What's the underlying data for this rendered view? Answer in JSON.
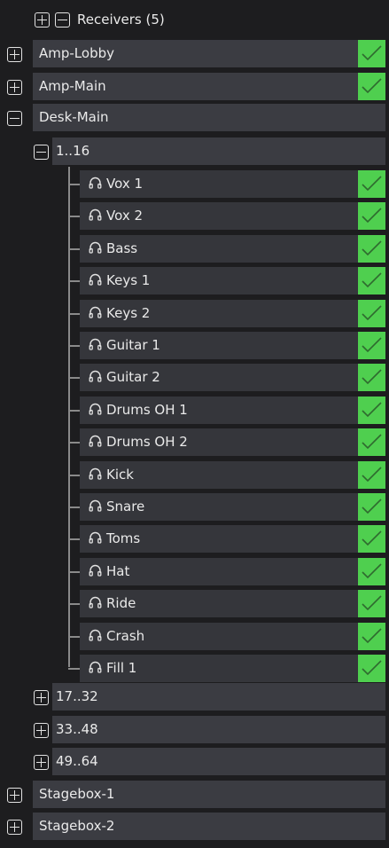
{
  "header": {
    "title": "Receivers",
    "count": "(5)"
  },
  "receivers": [
    {
      "label": "Amp-Lobby",
      "checked": true
    },
    {
      "label": "Amp-Main",
      "checked": true
    },
    {
      "label": "Desk-Main",
      "checked": false
    }
  ],
  "desk_main": {
    "group_label": "1..16",
    "channels": [
      {
        "label": "Vox 1",
        "checked": true
      },
      {
        "label": "Vox 2",
        "checked": true
      },
      {
        "label": "Bass",
        "checked": true
      },
      {
        "label": "Keys 1",
        "checked": true
      },
      {
        "label": "Keys 2",
        "checked": true
      },
      {
        "label": "Guitar 1",
        "checked": true
      },
      {
        "label": "Guitar 2",
        "checked": true
      },
      {
        "label": "Drums OH 1",
        "checked": true
      },
      {
        "label": "Drums OH 2",
        "checked": true
      },
      {
        "label": "Kick",
        "checked": true
      },
      {
        "label": "Snare",
        "checked": true
      },
      {
        "label": "Toms",
        "checked": true
      },
      {
        "label": "Hat",
        "checked": true
      },
      {
        "label": "Ride",
        "checked": true
      },
      {
        "label": "Crash",
        "checked": true
      },
      {
        "label": "Fill 1",
        "checked": true
      }
    ],
    "collapsed_groups": [
      "17..32",
      "33..48",
      "49..64"
    ]
  },
  "stageboxes": [
    {
      "label": "Stagebox-1"
    },
    {
      "label": "Stagebox-2"
    }
  ],
  "colors": {
    "background": "#1d1d1f",
    "row": "#3b3c42",
    "check": "#4fcf4f"
  },
  "icons": {
    "expand": "plus-square-icon",
    "collapse": "minus-square-icon",
    "channel": "headphones-icon",
    "checked": "checkmark-icon"
  }
}
